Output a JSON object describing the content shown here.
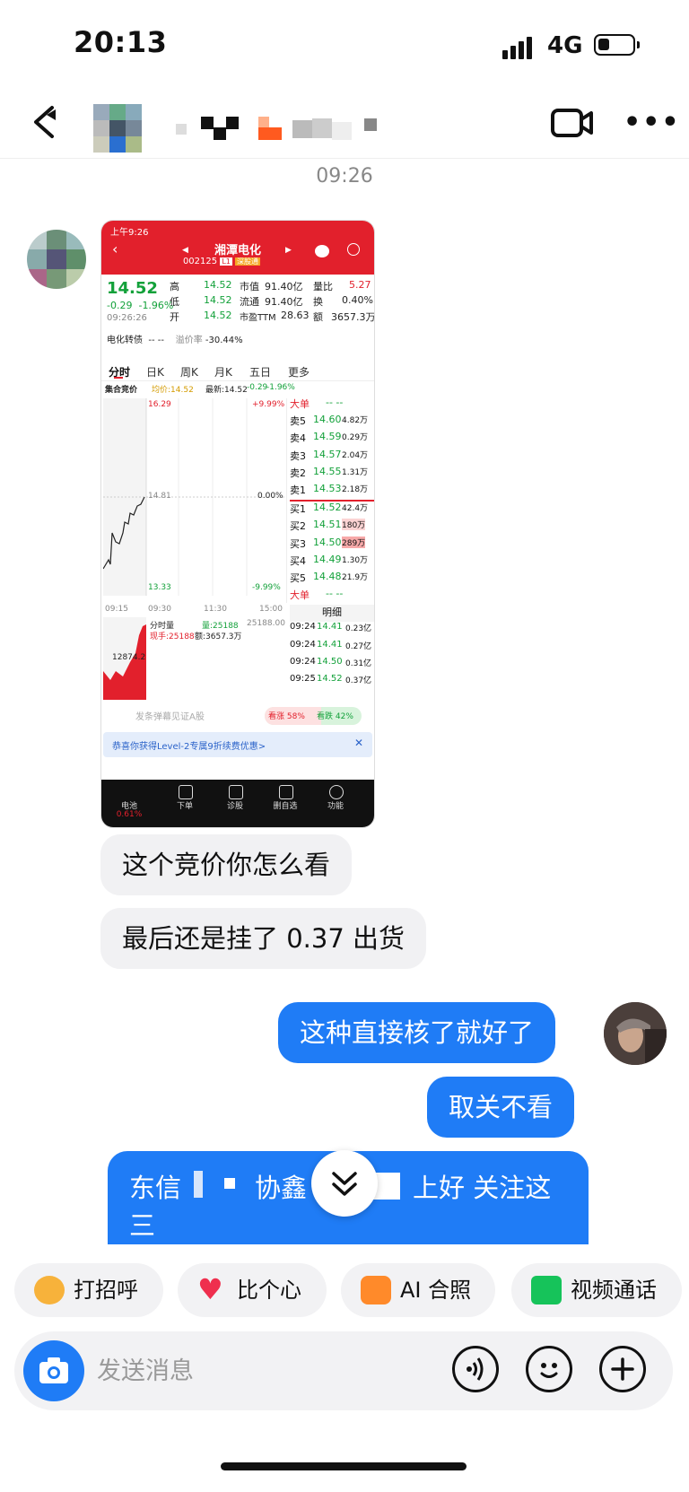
{
  "status_bar": {
    "time": "20:13",
    "network": "4G"
  },
  "chat": {
    "timestamp": "09:26",
    "messages_left": [
      "这个竞价你怎么看",
      "最后还是挂了 0.37 出货"
    ],
    "messages_right": [
      "这种直接核了就好了",
      "取关不看"
    ],
    "partial_message_line1": "东信",
    "partial_message_middle": "协鑫",
    "partial_message_tail": "上好 关注这",
    "partial_message_line2": "三"
  },
  "stock_screenshot": {
    "status_time": "上午9:26",
    "name": "湘潭电化",
    "code": "002125",
    "code_badge": "L1",
    "code_badge2": "深股通",
    "price": "14.52",
    "change": "-0.29",
    "change_pct": "-1.96%",
    "time": "09:26:26",
    "rows": [
      {
        "label": "高",
        "val": "14.52",
        "label2": "市值",
        "val2": "91.40亿",
        "label3": "量比",
        "val3": "5.27"
      },
      {
        "label": "低",
        "val": "14.52",
        "label2": "流通",
        "val2": "91.40亿",
        "label3": "换",
        "val3": "0.40%"
      },
      {
        "label": "开",
        "val": "14.52",
        "label2": "市盈TTM",
        "val2": "28.63",
        "label3": "额",
        "val3": "3657.3万"
      }
    ],
    "convert_label": "电化转债",
    "convert_val": "-- --",
    "premium_label": "溢价率",
    "premium_val": "-30.44%",
    "tabs": [
      "分时",
      "日K",
      "周K",
      "月K",
      "五日",
      "更多"
    ],
    "auction_label": "集合竞价",
    "avg_label": "均价:14.52",
    "latest_label": "最新:14.52",
    "latest_change": "-0.29",
    "latest_pct": "-1.96%",
    "chart_high": "16.29",
    "chart_high_pct": "+9.99%",
    "chart_mid": "14.81",
    "chart_mid_pct": "0.00%",
    "chart_low": "13.33",
    "chart_low_pct": "-9.99%",
    "x_ticks": [
      "09:15",
      "09:30",
      "11:30",
      "15:00"
    ],
    "volume_label": "分时量",
    "volume_val": "量:25188",
    "volume_max": "25188.00",
    "now_hand": "现手:25188",
    "amount": "额:3657.3万",
    "vol_level": "12874.2",
    "order_book_header": "大单",
    "order_book_dashes": "--  --",
    "asks": [
      {
        "label": "卖5",
        "price": "14.60",
        "vol": "4.82万"
      },
      {
        "label": "卖4",
        "price": "14.59",
        "vol": "0.29万"
      },
      {
        "label": "卖3",
        "price": "14.57",
        "vol": "2.04万"
      },
      {
        "label": "卖2",
        "price": "14.55",
        "vol": "1.31万"
      },
      {
        "label": "卖1",
        "price": "14.53",
        "vol": "2.18万"
      }
    ],
    "bids": [
      {
        "label": "买1",
        "price": "14.52",
        "vol": "42.4万"
      },
      {
        "label": "买2",
        "price": "14.51",
        "vol": "180万"
      },
      {
        "label": "买3",
        "price": "14.50",
        "vol": "289万"
      },
      {
        "label": "买4",
        "price": "14.49",
        "vol": "1.30万"
      },
      {
        "label": "买5",
        "price": "14.48",
        "vol": "21.9万"
      }
    ],
    "order_book_footer": "大单",
    "detail_label": "明细",
    "trades": [
      {
        "time": "09:24",
        "price": "14.41",
        "vol": "0.23亿"
      },
      {
        "time": "09:24",
        "price": "14.41",
        "vol": "0.27亿"
      },
      {
        "time": "09:24",
        "price": "14.50",
        "vol": "0.31亿"
      },
      {
        "time": "09:25",
        "price": "14.52",
        "vol": "0.37亿"
      }
    ],
    "comment_placeholder": "发条弹幕见证A股",
    "bull": "看涨 58%",
    "bear": "看跌 42%",
    "bull_share": 0.58,
    "promo": "恭喜你获得Level-2专属9折续费优惠>",
    "bottom_tabs": [
      "电池",
      "下单",
      "诊股",
      "删自选",
      "功能"
    ],
    "bottom_first_sub": "0.61%"
  },
  "quick_actions": [
    "打招呼",
    "比个心",
    "AI 合照",
    "视频通话"
  ],
  "input": {
    "placeholder": "发送消息"
  },
  "colors": {
    "accent": "#1f7cf6",
    "stock_red": "#e2202c",
    "stock_green": "#13a13a"
  }
}
